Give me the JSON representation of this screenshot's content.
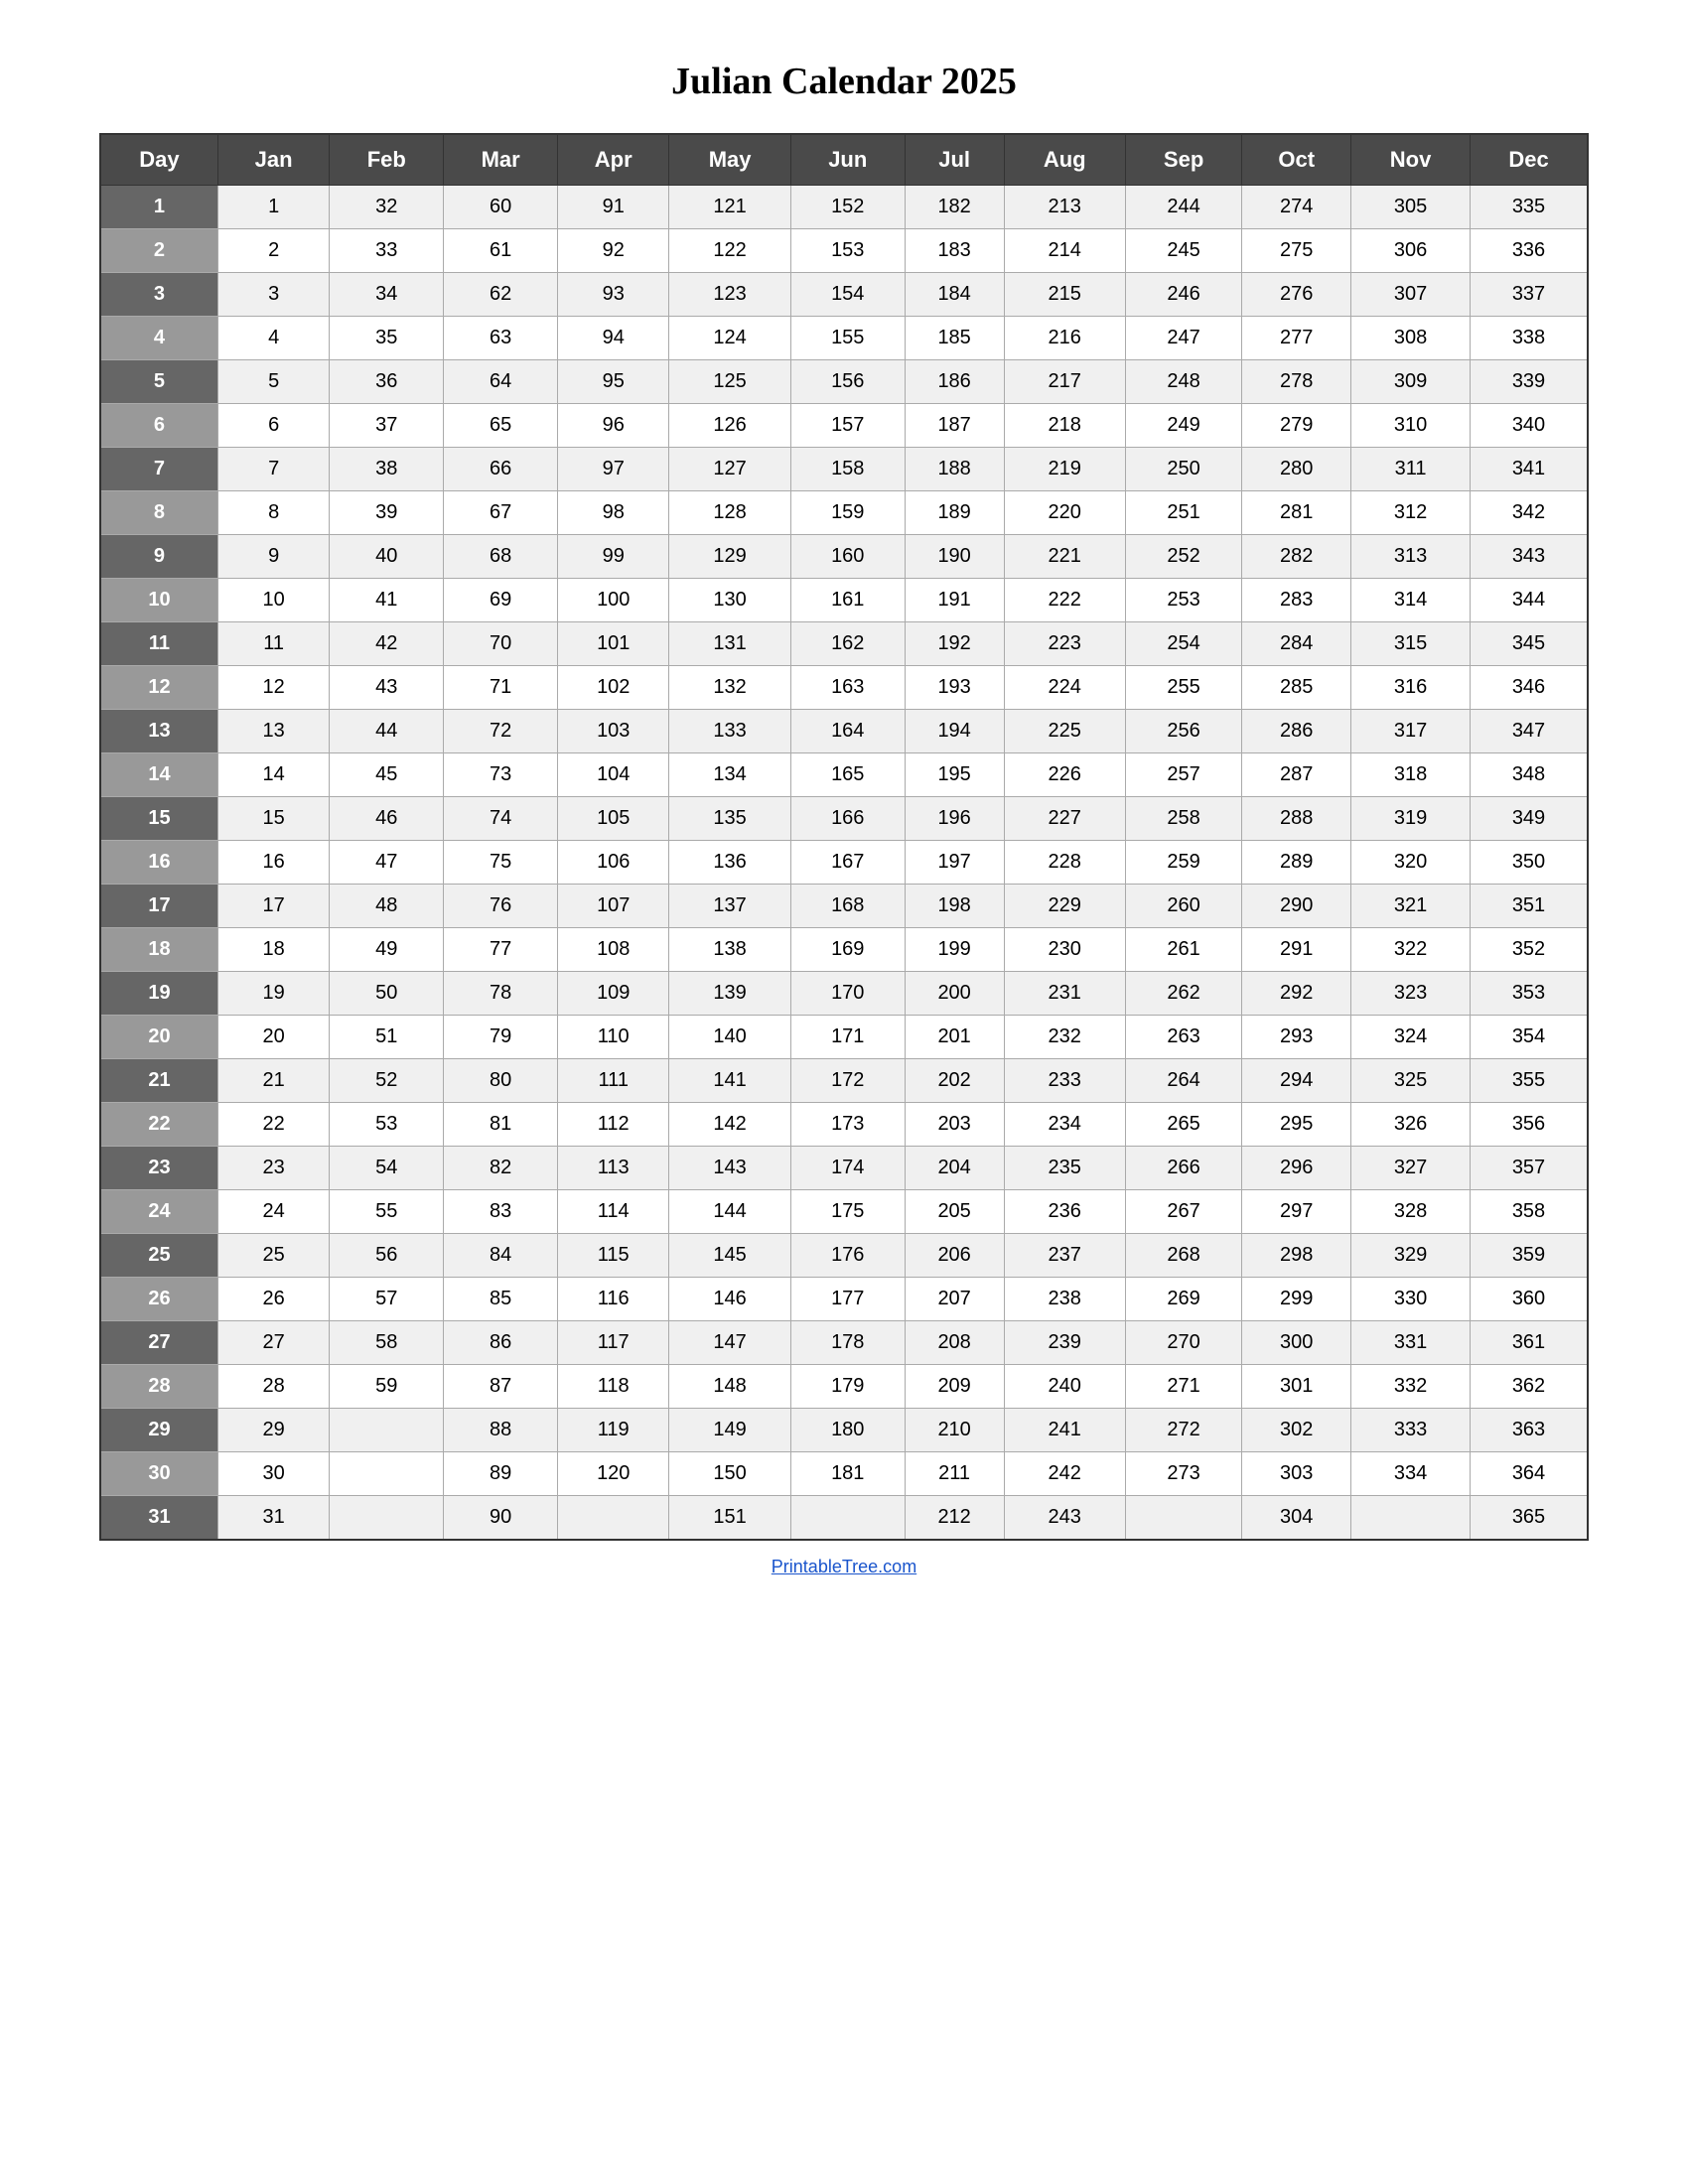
{
  "title": "Julian Calendar 2025",
  "headers": [
    "Day",
    "Jan",
    "Feb",
    "Mar",
    "Apr",
    "May",
    "Jun",
    "Jul",
    "Aug",
    "Sep",
    "Oct",
    "Nov",
    "Dec"
  ],
  "rows": [
    [
      1,
      1,
      32,
      60,
      91,
      121,
      152,
      182,
      213,
      244,
      274,
      305,
      335
    ],
    [
      2,
      2,
      33,
      61,
      92,
      122,
      153,
      183,
      214,
      245,
      275,
      306,
      336
    ],
    [
      3,
      3,
      34,
      62,
      93,
      123,
      154,
      184,
      215,
      246,
      276,
      307,
      337
    ],
    [
      4,
      4,
      35,
      63,
      94,
      124,
      155,
      185,
      216,
      247,
      277,
      308,
      338
    ],
    [
      5,
      5,
      36,
      64,
      95,
      125,
      156,
      186,
      217,
      248,
      278,
      309,
      339
    ],
    [
      6,
      6,
      37,
      65,
      96,
      126,
      157,
      187,
      218,
      249,
      279,
      310,
      340
    ],
    [
      7,
      7,
      38,
      66,
      97,
      127,
      158,
      188,
      219,
      250,
      280,
      311,
      341
    ],
    [
      8,
      8,
      39,
      67,
      98,
      128,
      159,
      189,
      220,
      251,
      281,
      312,
      342
    ],
    [
      9,
      9,
      40,
      68,
      99,
      129,
      160,
      190,
      221,
      252,
      282,
      313,
      343
    ],
    [
      10,
      10,
      41,
      69,
      100,
      130,
      161,
      191,
      222,
      253,
      283,
      314,
      344
    ],
    [
      11,
      11,
      42,
      70,
      101,
      131,
      162,
      192,
      223,
      254,
      284,
      315,
      345
    ],
    [
      12,
      12,
      43,
      71,
      102,
      132,
      163,
      193,
      224,
      255,
      285,
      316,
      346
    ],
    [
      13,
      13,
      44,
      72,
      103,
      133,
      164,
      194,
      225,
      256,
      286,
      317,
      347
    ],
    [
      14,
      14,
      45,
      73,
      104,
      134,
      165,
      195,
      226,
      257,
      287,
      318,
      348
    ],
    [
      15,
      15,
      46,
      74,
      105,
      135,
      166,
      196,
      227,
      258,
      288,
      319,
      349
    ],
    [
      16,
      16,
      47,
      75,
      106,
      136,
      167,
      197,
      228,
      259,
      289,
      320,
      350
    ],
    [
      17,
      17,
      48,
      76,
      107,
      137,
      168,
      198,
      229,
      260,
      290,
      321,
      351
    ],
    [
      18,
      18,
      49,
      77,
      108,
      138,
      169,
      199,
      230,
      261,
      291,
      322,
      352
    ],
    [
      19,
      19,
      50,
      78,
      109,
      139,
      170,
      200,
      231,
      262,
      292,
      323,
      353
    ],
    [
      20,
      20,
      51,
      79,
      110,
      140,
      171,
      201,
      232,
      263,
      293,
      324,
      354
    ],
    [
      21,
      21,
      52,
      80,
      111,
      141,
      172,
      202,
      233,
      264,
      294,
      325,
      355
    ],
    [
      22,
      22,
      53,
      81,
      112,
      142,
      173,
      203,
      234,
      265,
      295,
      326,
      356
    ],
    [
      23,
      23,
      54,
      82,
      113,
      143,
      174,
      204,
      235,
      266,
      296,
      327,
      357
    ],
    [
      24,
      24,
      55,
      83,
      114,
      144,
      175,
      205,
      236,
      267,
      297,
      328,
      358
    ],
    [
      25,
      25,
      56,
      84,
      115,
      145,
      176,
      206,
      237,
      268,
      298,
      329,
      359
    ],
    [
      26,
      26,
      57,
      85,
      116,
      146,
      177,
      207,
      238,
      269,
      299,
      330,
      360
    ],
    [
      27,
      27,
      58,
      86,
      117,
      147,
      178,
      208,
      239,
      270,
      300,
      331,
      361
    ],
    [
      28,
      28,
      59,
      87,
      118,
      148,
      179,
      209,
      240,
      271,
      301,
      332,
      362
    ],
    [
      29,
      29,
      "",
      88,
      119,
      149,
      180,
      210,
      241,
      272,
      302,
      333,
      363
    ],
    [
      30,
      30,
      "",
      89,
      120,
      150,
      181,
      211,
      242,
      273,
      303,
      334,
      364
    ],
    [
      31,
      31,
      "",
      90,
      "",
      151,
      "",
      212,
      243,
      "",
      304,
      "",
      365
    ]
  ],
  "footer_link_text": "PrintableTree.com",
  "footer_link_url": "#"
}
